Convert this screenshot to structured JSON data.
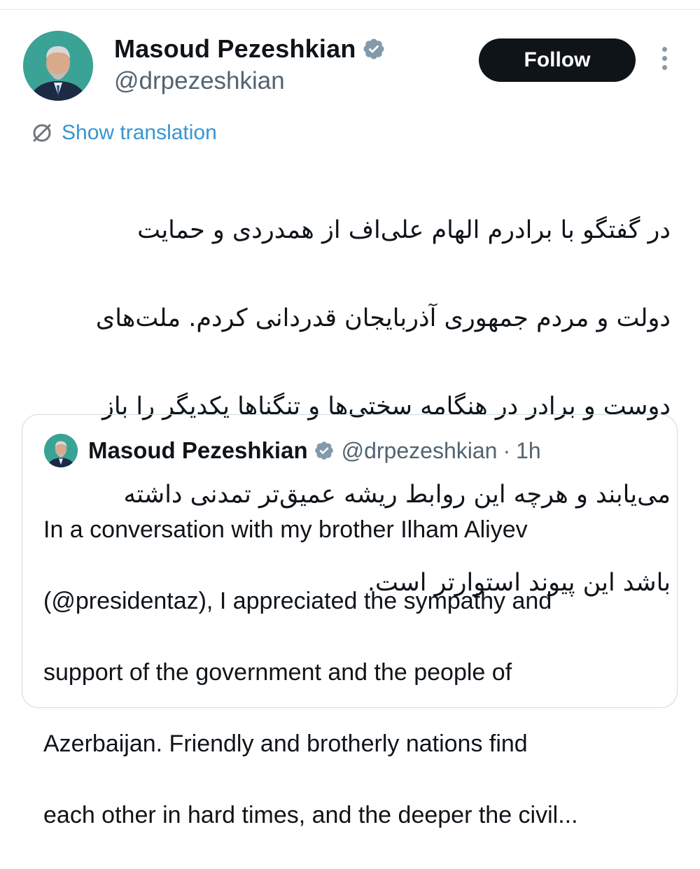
{
  "tweet": {
    "author": {
      "name": "Masoud Pezeshkian",
      "handle": "@drpezeshkian",
      "verified": true,
      "avatar": "avatar-photo"
    },
    "follow_label": "Follow",
    "more_icon": "more-vertical-icon",
    "translation_label": "Show translation",
    "translation_icon": "translate-icon",
    "text_lines": [
      "در گفتگو با برادرم الهام علی‌اف از همدردی و حمایت",
      "دولت و مردم جمهوری آذربایجان قدردانی کردم. ملت‌های",
      "دوست و برادر در هنگامه سختی‌ها و تنگناها یکدیگر را باز",
      "می‌یابند و هرچه این روابط ریشه عمیق‌تر تمدنی داشته",
      "باشد این پیوند استوارتر است."
    ]
  },
  "quoted": {
    "name": "Masoud Pezeshkian",
    "handle": "@drpezeshkian",
    "separator": "·",
    "time": "1h",
    "verified": true,
    "text_lines": [
      "In a conversation with my brother Ilham Aliyev",
      "(@presidentaz), I appreciated the sympathy and",
      "support of the government and the people of",
      "Azerbaijan. Friendly and brotherly nations find",
      "each other in hard times, and the deeper the civil..."
    ]
  },
  "colors": {
    "follow_bg": "#0f1419",
    "link": "#3795d4",
    "muted": "#536471",
    "border": "#cfd9de",
    "verified_badge": "#829aab"
  }
}
